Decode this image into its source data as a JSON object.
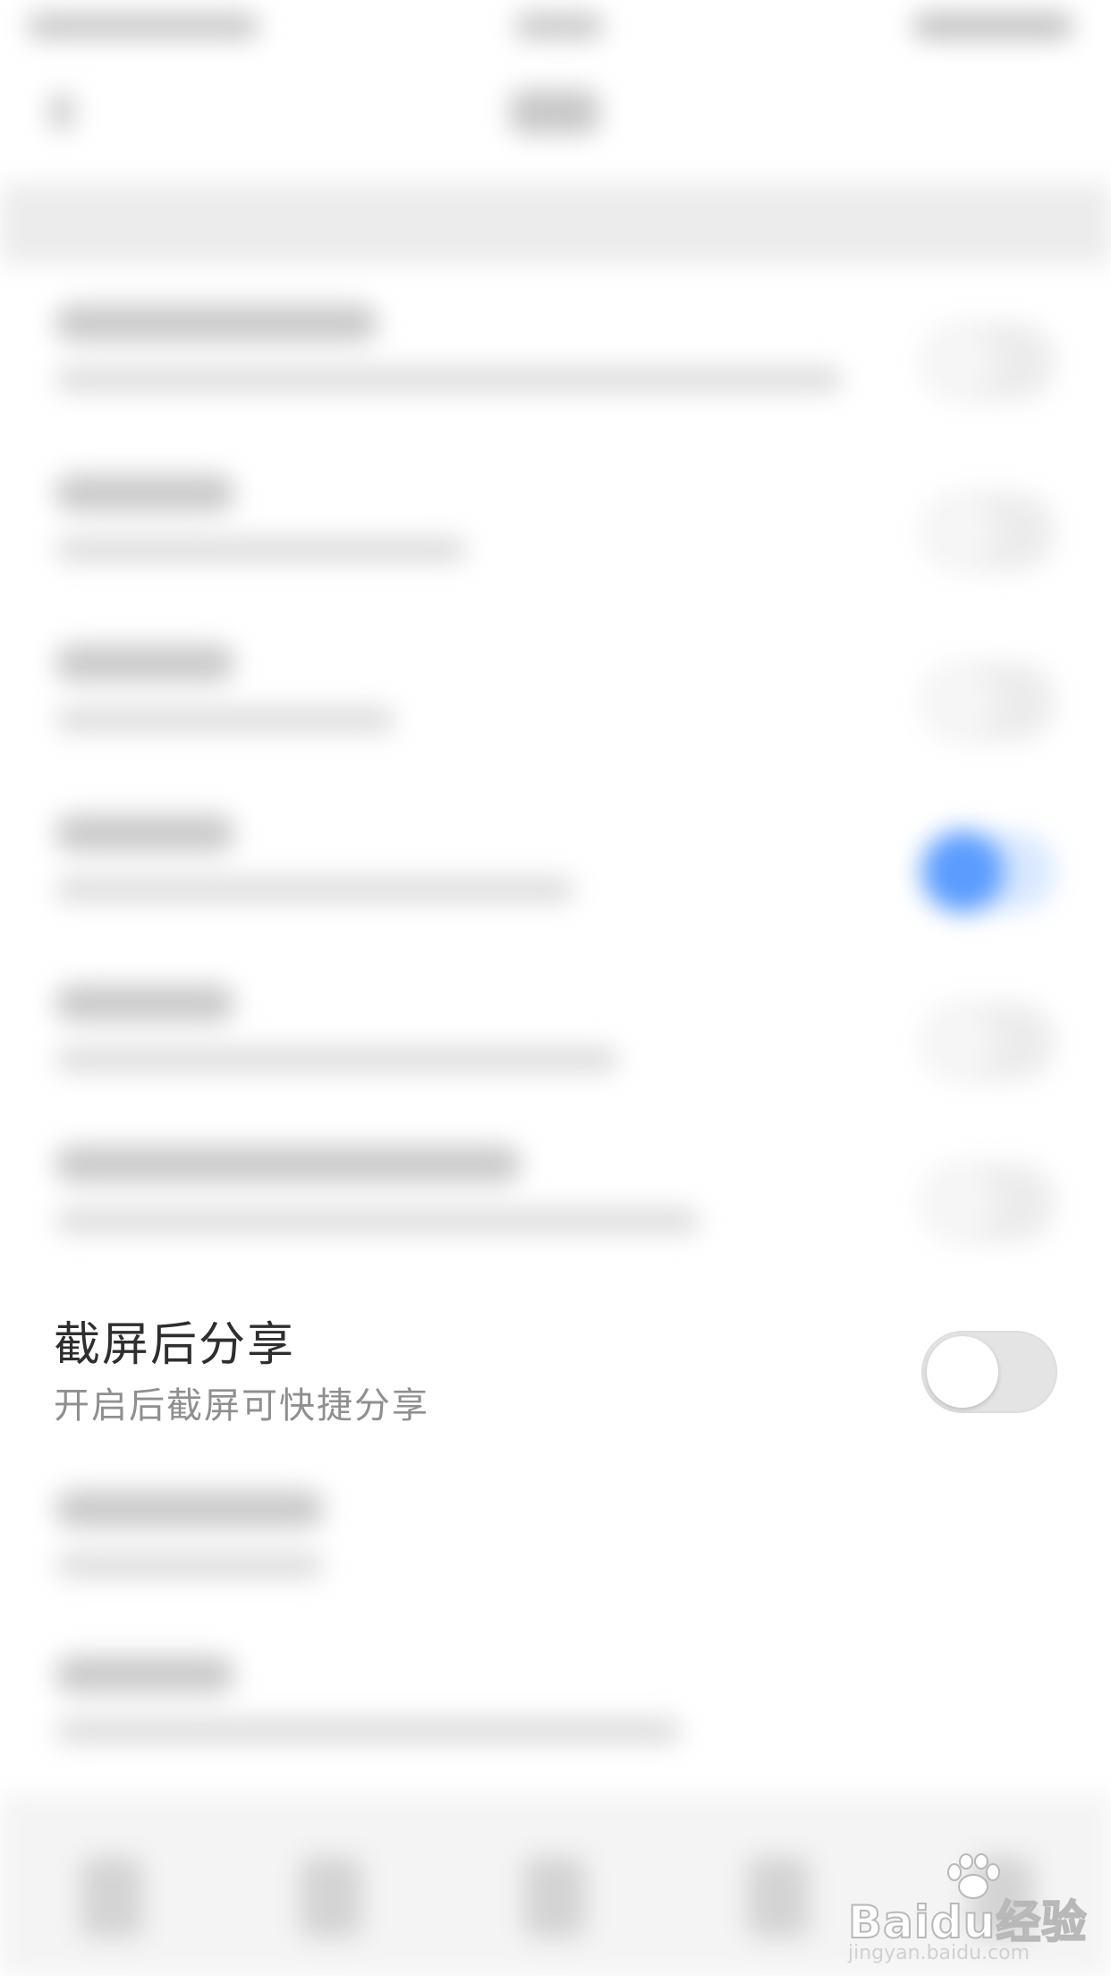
{
  "focused_setting": {
    "title": "截屏后分享",
    "subtitle": "开启后截屏可快捷分享",
    "toggle_on": false
  },
  "watermark": {
    "logo": "Baidu经验",
    "url": "jingyan.baidu.com"
  },
  "colors": {
    "accent_blue": "#5a9cff",
    "title_text": "#2e2e2e",
    "subtitle_text": "#8f8f8f",
    "toggle_off_track": "#e4e4e4"
  }
}
